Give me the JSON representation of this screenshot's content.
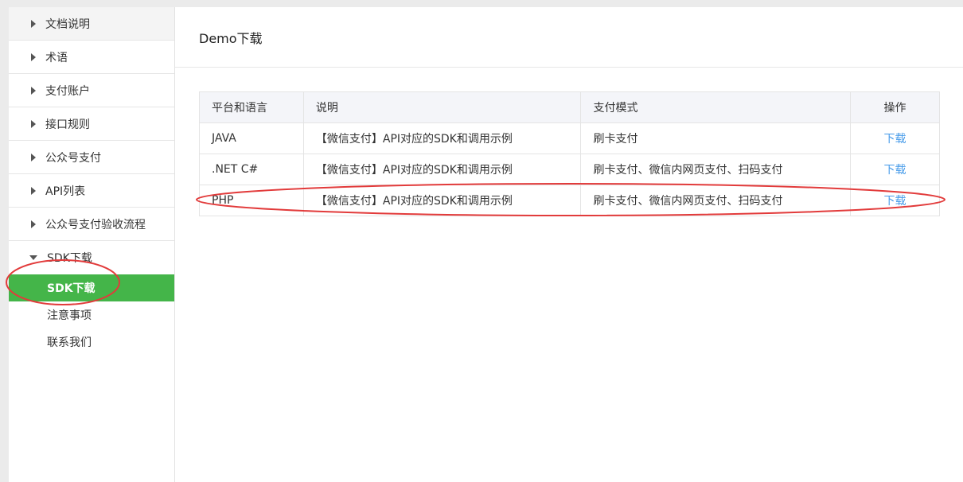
{
  "sidebar": {
    "items": [
      {
        "label": "文档说明"
      },
      {
        "label": "术语"
      },
      {
        "label": "支付账户"
      },
      {
        "label": "接口规则"
      },
      {
        "label": "公众号支付"
      },
      {
        "label": "API列表"
      },
      {
        "label": "公众号支付验收流程"
      },
      {
        "label": "SDK下载"
      }
    ],
    "sub_items": [
      {
        "label": "SDK下载",
        "active": true
      },
      {
        "label": "注意事项"
      },
      {
        "label": "联系我们"
      }
    ]
  },
  "main": {
    "title": "Demo下载",
    "table": {
      "headers": [
        "平台和语言",
        "说明",
        "支付模式",
        "操作"
      ],
      "rows": [
        {
          "platform": "JAVA",
          "desc": "【微信支付】API对应的SDK和调用示例",
          "mode": "刷卡支付",
          "action": "下载"
        },
        {
          "platform": ".NET C#",
          "desc": "【微信支付】API对应的SDK和调用示例",
          "mode": "刷卡支付、微信内网页支付、扫码支付",
          "action": "下载"
        },
        {
          "platform": "PHP",
          "desc": "【微信支付】API对应的SDK和调用示例",
          "mode": "刷卡支付、微信内网页支付、扫码支付",
          "action": "下载"
        }
      ]
    }
  },
  "colors": {
    "accent_green": "#44b549",
    "link_blue": "#459ae9",
    "annotation_red": "#e23b3b"
  }
}
